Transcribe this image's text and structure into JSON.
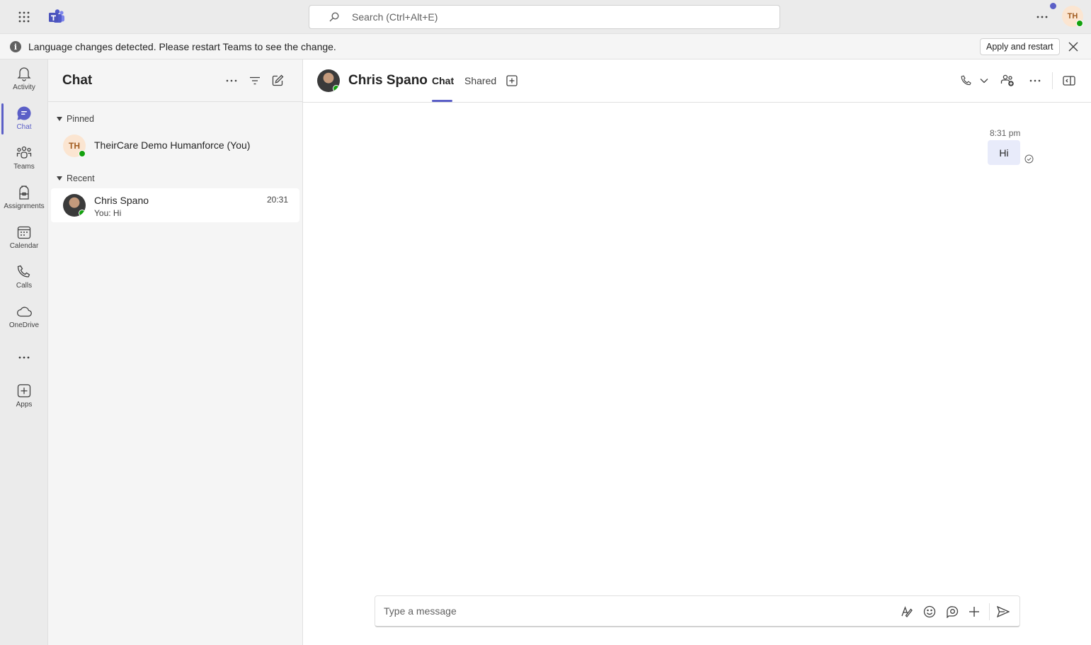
{
  "topbar": {
    "search_placeholder": "Search (Ctrl+Alt+E)",
    "me_initials": "TH"
  },
  "banner": {
    "message": "Language changes detected. Please restart Teams to see the change.",
    "apply_label": "Apply and restart",
    "info_glyph": "i"
  },
  "rail": {
    "items": [
      {
        "label": "Activity",
        "icon": "bell-icon"
      },
      {
        "label": "Chat",
        "icon": "chat-icon"
      },
      {
        "label": "Teams",
        "icon": "teams-icon"
      },
      {
        "label": "Assignments",
        "icon": "assignments-icon"
      },
      {
        "label": "Calendar",
        "icon": "calendar-icon"
      },
      {
        "label": "Calls",
        "icon": "phone-icon"
      },
      {
        "label": "OneDrive",
        "icon": "cloud-icon"
      },
      {
        "label": "Apps",
        "icon": "add-app-icon"
      }
    ]
  },
  "chatlist": {
    "title": "Chat",
    "pinned_label": "Pinned",
    "recent_label": "Recent",
    "pinned": [
      {
        "initials": "TH",
        "name": "TheirCare Demo Humanforce (You)"
      }
    ],
    "recent": [
      {
        "name": "Chris Spano",
        "time": "20:31",
        "preview": "You: Hi"
      }
    ]
  },
  "conversation": {
    "name": "Chris Spano",
    "tabs": [
      "Chat",
      "Shared"
    ],
    "messages": [
      {
        "time": "8:31 pm",
        "text": "Hi"
      }
    ],
    "composer_placeholder": "Type a message"
  },
  "colors": {
    "accent": "#5b5fc7",
    "presence_available": "#13a10e",
    "bubble_self": "#e8ebfa"
  }
}
